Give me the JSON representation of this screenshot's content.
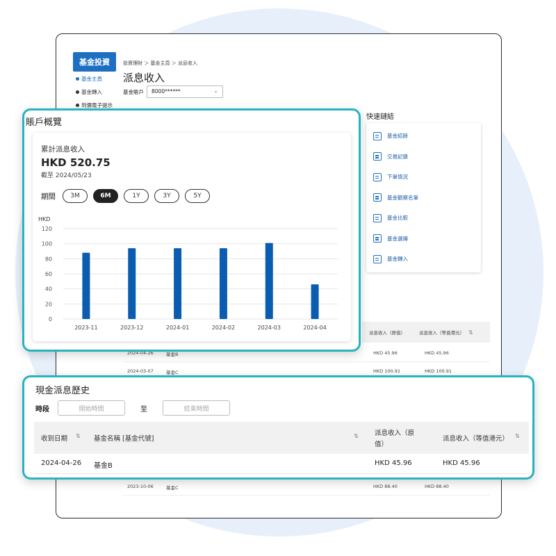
{
  "sidebar": {
    "header": "基金投資",
    "items": [
      {
        "label": "基金主頁",
        "active": true
      },
      {
        "label": "基金轉入",
        "active": false
      },
      {
        "label": "到價電子提示",
        "active": false
      }
    ]
  },
  "breadcrumb": "投資理財 ＞ 基金主頁 ＞ 派息收入",
  "page_title": "派息收入",
  "account": {
    "label": "基金賬戶",
    "value": "8000******"
  },
  "quick_links": {
    "title": "快速鏈結",
    "items": [
      "基金結餘",
      "交易記錄",
      "下單情況",
      "基金觀察名單",
      "基金比較",
      "基金選擇",
      "基金轉入"
    ]
  },
  "background_table": {
    "headers": [
      "派息收入（原值）",
      "派息收入（等值港元）"
    ],
    "rows": [
      {
        "date": "2024-04-26",
        "fund": "基金B",
        "orig": "HKD 45.96",
        "hkd": "HKD 45.96"
      },
      {
        "date": "2024-03-07",
        "fund": "基金C",
        "orig": "HKD 100.91",
        "hkd": "HKD 100.91"
      },
      {
        "date": "2023-10-06",
        "fund": "基金C",
        "orig": "HKD 88.40",
        "hkd": "HKD 88.40"
      }
    ]
  },
  "overview": {
    "title": "賬戶概覽",
    "cumulative_label": "累計派息收入",
    "amount": "HKD 520.75",
    "as_of": "截至 2024/05/23",
    "period_label": "期間",
    "periods": [
      "3M",
      "6M",
      "1Y",
      "3Y",
      "5Y"
    ],
    "selected_period": "6M"
  },
  "chart_data": {
    "type": "bar",
    "ylabel": "HKD",
    "ylim": [
      0,
      120
    ],
    "yticks": [
      0,
      20,
      40,
      60,
      80,
      100,
      120
    ],
    "categories": [
      "2023-11",
      "2023-12",
      "2024-01",
      "2024-02",
      "2024-03",
      "2024-04"
    ],
    "values": [
      88,
      94,
      94,
      94,
      101,
      46
    ],
    "color": "#0a5cb0",
    "grid": true
  },
  "history": {
    "title": "現金派息歷史",
    "period_label": "時段",
    "start_placeholder": "開始時間",
    "to_label": "至",
    "end_placeholder": "結束時間",
    "headers": {
      "date": "收到日期",
      "fund": "基金名稱 [基金代號]",
      "orig_line1": "派息收入（原",
      "orig_line2": "值）",
      "hkd": "派息收入（等值港元）"
    },
    "row": {
      "date": "2024-04-26",
      "fund": "基金B",
      "orig": "HKD 45.96",
      "hkd": "HKD 45.96"
    }
  },
  "colors": {
    "brand": "#1e6fc2",
    "bar": "#0a5cb0",
    "highlight_border": "#27b3bf",
    "bg_circle": "#e7f0fa"
  }
}
